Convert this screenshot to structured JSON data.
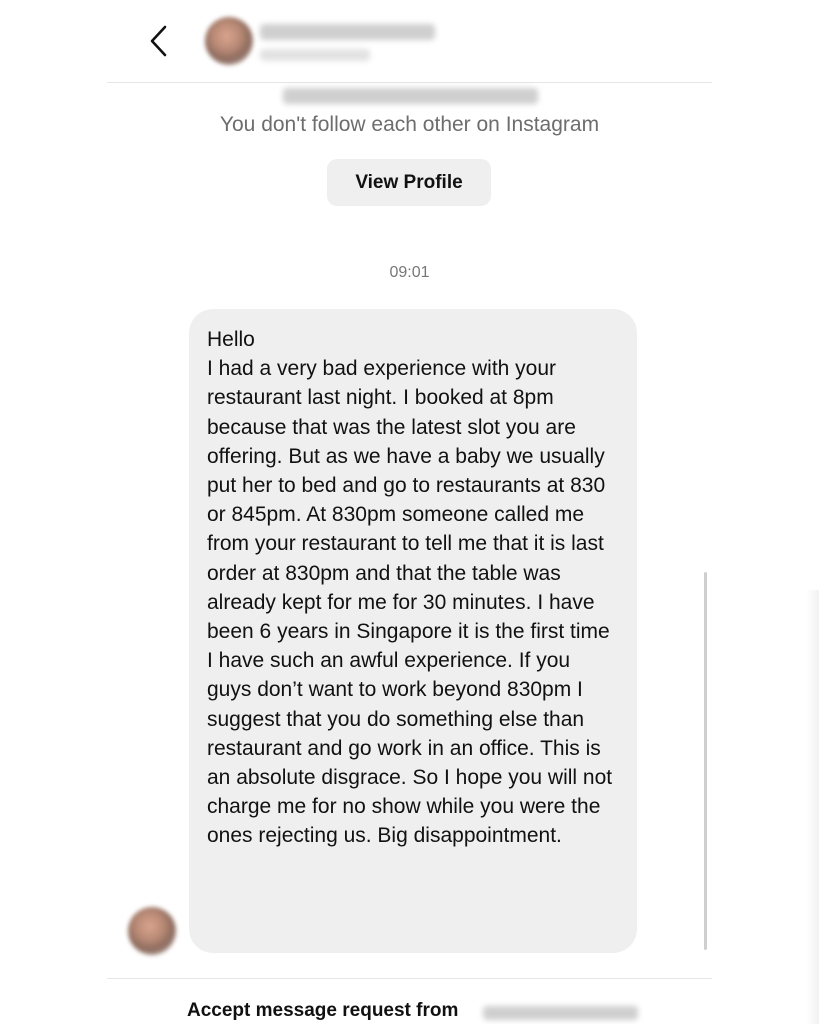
{
  "header": {
    "back_icon": "chevron-left-icon"
  },
  "profile": {
    "follow_note": "You don't follow each other on Instagram",
    "view_profile_label": "View Profile"
  },
  "conversation": {
    "timestamp": "09:01",
    "message": "Hello\nI had a very bad experience with your restaurant last night. I booked at 8pm because that was the latest slot you are offering. But as we have a baby we usually put her to bed and go to restaurants at 830 or 845pm. At 830pm someone called me from your restaurant to tell me that it is last order at 830pm and that the table was already kept for me for 30 minutes. I have been 6 years in Singapore it is the first time I have such an awful experience. If you guys don’t want to work beyond 830pm I suggest that you do something else than restaurant and go work in an office. This is an absolute disgrace. So I hope you will not charge me for no show while you were the ones rejecting us. Big disappointment."
  },
  "footer": {
    "accept_label": "Accept message request from"
  },
  "colors": {
    "bubble_bg": "#efefef",
    "secondary_text": "#6d6d6d",
    "button_bg": "#efefef"
  }
}
